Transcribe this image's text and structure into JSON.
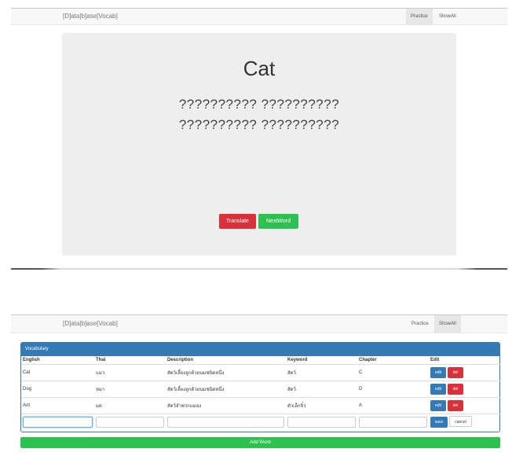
{
  "nav": {
    "brand": "[D]ata[b]ase[Vocab]",
    "practice": "Practice",
    "showall": "ShowAll"
  },
  "practice_card": {
    "word": "Cat",
    "description_line1": "?????????? ??????????",
    "description_line2": "?????????? ??????????",
    "translate_label": "Translate",
    "next_label": "NextWord"
  },
  "vocab_panel": {
    "title": "Vocabulary",
    "columns": [
      "English",
      "Thai",
      "Description",
      "Keyword",
      "Chapter",
      "Edit"
    ],
    "rows": [
      {
        "english": "Cat",
        "thai": "แมว",
        "description": "สัตว์เลี้ยงลูกด้วยนมชนิดหนึ่ง",
        "keyword": "สัตว์",
        "chapter": "C"
      },
      {
        "english": "Dog",
        "thai": "หมา",
        "description": "สัตว์เลี้ยงลูกด้วยนมชนิดหนึ่ง",
        "keyword": "สัตว์",
        "chapter": "D"
      },
      {
        "english": "Ant",
        "thai": "มด",
        "description": "สัตว์จำพวกแมลง",
        "keyword": "ตัวเล็กจิ๋ว",
        "chapter": "A"
      }
    ],
    "edit_label": "edit",
    "del_label": "del",
    "save_label": "save",
    "cancel_label": "cancel",
    "add_word_label": "Add Word"
  },
  "colors": {
    "danger": "#d9303a",
    "success": "#2ec050",
    "primary": "#337ab7"
  }
}
